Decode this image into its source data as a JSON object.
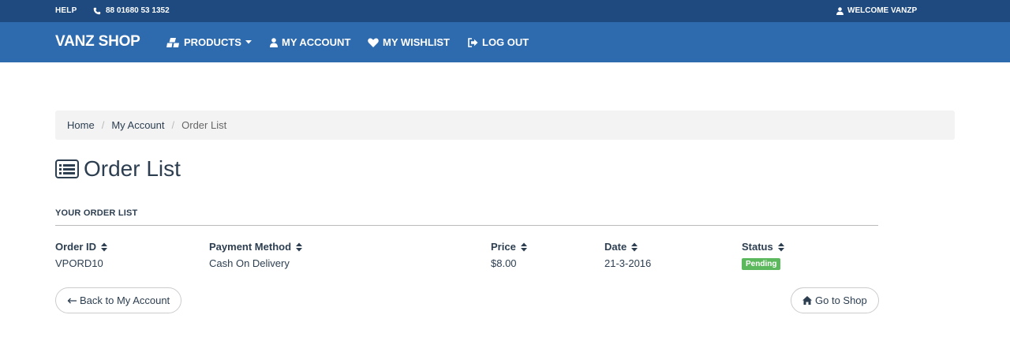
{
  "topbar": {
    "help": "HELP",
    "phone": "88 01680 53 1352",
    "welcome": "WELCOME VANZP"
  },
  "navbar": {
    "brand": "VANZ SHOP",
    "products": "PRODUCTS",
    "my_account": "MY ACCOUNT",
    "my_wishlist": "MY WISHLIST",
    "log_out": "LOG OUT"
  },
  "breadcrumb": {
    "home": "Home",
    "my_account": "My Account",
    "current": "Order List",
    "separator": "/"
  },
  "page": {
    "title": "Order List",
    "section_label": "YOUR ORDER LIST"
  },
  "table": {
    "headers": {
      "order_id": "Order ID",
      "payment_method": "Payment Method",
      "price": "Price",
      "date": "Date",
      "status": "Status"
    },
    "rows": [
      {
        "order_id": "VPORD10",
        "payment_method": "Cash On Delivery",
        "price": "$8.00",
        "date": "21-3-2016",
        "status": "Pending"
      }
    ]
  },
  "buttons": {
    "back": "Back to My Account",
    "shop": "Go to Shop"
  },
  "colors": {
    "topbar": "#1e4a80",
    "navbar": "#2d6aae",
    "status_pending": "#5cb85c",
    "text": "#2c3e50"
  }
}
